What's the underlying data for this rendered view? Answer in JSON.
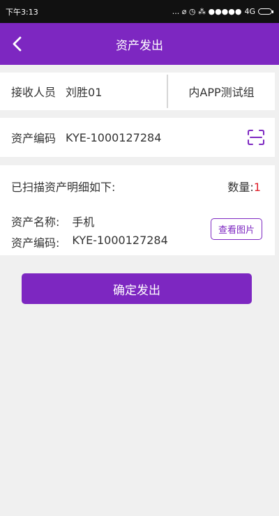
{
  "status_bar": {
    "time": "下午3:13",
    "network": "4G",
    "indicators": "... ⌀ ◷ ⁂ ●●●●●"
  },
  "header": {
    "title": "资产发出"
  },
  "recipient": {
    "label": "接收人员",
    "name": "刘胜01",
    "group": "内APP测试组"
  },
  "asset_code_field": {
    "label": "资产编码",
    "value": "KYE-1000127284"
  },
  "detail": {
    "heading": "已扫描资产明细如下:",
    "count_label": "数量:",
    "count_value": "1",
    "name_label": "资产名称:",
    "name_value": "手机",
    "code_label": "资产编码:",
    "code_value": "KYE-1000127284",
    "view_image_label": "查看图片"
  },
  "confirm_label": "确定发出",
  "colors": {
    "primary": "#7d27c1",
    "count": "#e0202a",
    "background": "#f0f0f0"
  }
}
